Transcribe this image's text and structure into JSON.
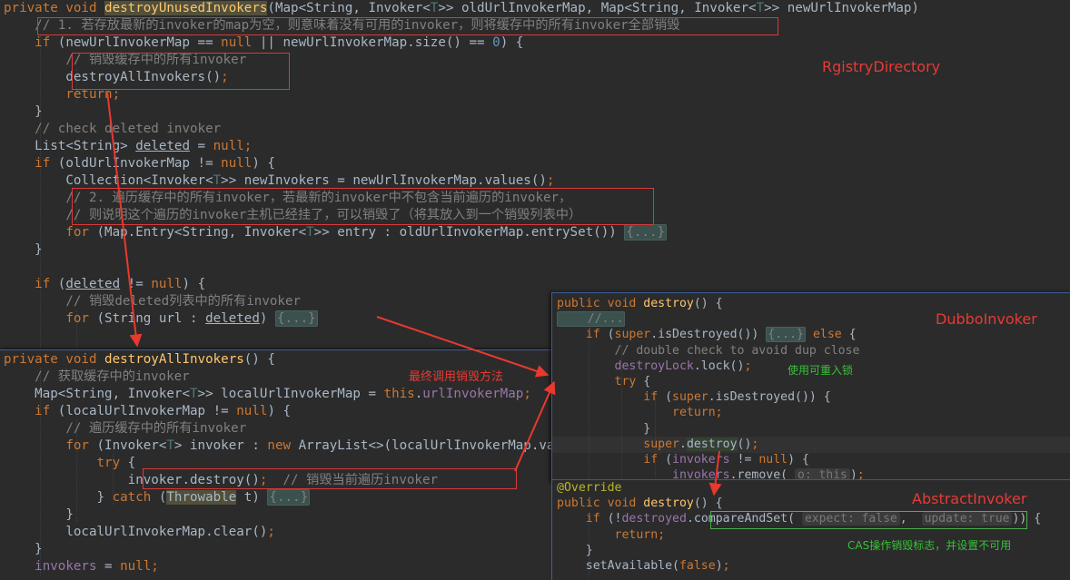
{
  "main_editor": {
    "lines": [
      {
        "p": [
          [
            "kw",
            "private void "
          ],
          [
            "fn hl-yel",
            "destroyUnusedInvokers"
          ],
          [
            "",
            "(Map<String, Invoker<"
          ],
          [
            "tp",
            "T"
          ],
          [
            "",
            ">> oldUrlInvokerMap, Map<String, Invoker<"
          ],
          [
            "tp",
            "T"
          ],
          [
            "",
            ">> newUrlInvokerMap)"
          ]
        ]
      },
      {
        "p": [
          [
            "cm",
            "    // 1. 若存放最新的invoker的map为空，则意味着没有可用的invoker，则将缓存中的所有invoker全部销毁"
          ]
        ]
      },
      {
        "p": [
          [
            "kw",
            "    if "
          ],
          [
            "",
            "(newUrlInvokerMap == "
          ],
          [
            "kw",
            "null"
          ],
          [
            "",
            " || newUrlInvokerMap.size() == "
          ],
          [
            "num",
            "0"
          ],
          [
            "",
            ") {"
          ]
        ]
      },
      {
        "p": [
          [
            "cm",
            "        // 销毁缓存中的所有invoker"
          ]
        ]
      },
      {
        "p": [
          [
            "",
            "        destroyAllInvokers()"
          ],
          [
            "kw",
            ";"
          ]
        ]
      },
      {
        "p": [
          [
            "kw",
            "        return;"
          ]
        ]
      },
      {
        "p": [
          [
            "",
            "    }"
          ]
        ]
      },
      {
        "p": [
          [
            "cm",
            "    // check deleted invoker"
          ]
        ]
      },
      {
        "p": [
          [
            "",
            "    List<String> "
          ],
          [
            "ul",
            "deleted"
          ],
          [
            "",
            " = "
          ],
          [
            "kw",
            "null;"
          ]
        ]
      },
      {
        "p": [
          [
            "kw",
            "    if "
          ],
          [
            "",
            "(oldUrlInvokerMap != "
          ],
          [
            "kw",
            "null"
          ],
          [
            "",
            ") {"
          ]
        ]
      },
      {
        "p": [
          [
            "",
            "        Collection<Invoker<"
          ],
          [
            "tp",
            "T"
          ],
          [
            "",
            ">> newInvokers = newUrlInvokerMap.values()"
          ],
          [
            "kw",
            ";"
          ]
        ]
      },
      {
        "p": [
          [
            "cm",
            "        // 2. 遍历缓存中的所有invoker，若最新的invoker中不包含当前遍历的invoker，"
          ]
        ]
      },
      {
        "p": [
          [
            "cm",
            "        // 则说明这个遍历的invoker主机已经挂了，可以销毁了（将其放入到一个销毁列表中）"
          ]
        ]
      },
      {
        "p": [
          [
            "kw",
            "        for "
          ],
          [
            "",
            "(Map.Entry<String, Invoker<"
          ],
          [
            "tp",
            "T"
          ],
          [
            "",
            ">> entry : oldUrlInvokerMap.entrySet()) "
          ],
          [
            "fold",
            "{...}"
          ]
        ]
      },
      {
        "p": [
          [
            "",
            "    }"
          ]
        ]
      },
      {
        "p": [
          [
            "",
            ""
          ]
        ]
      },
      {
        "p": [
          [
            "kw",
            "    if "
          ],
          [
            "",
            "("
          ],
          [
            "ul",
            "deleted"
          ],
          [
            "",
            " != "
          ],
          [
            "kw",
            "null"
          ],
          [
            "",
            ") {"
          ]
        ]
      },
      {
        "p": [
          [
            "cm",
            "        // 销毁deleted列表中的所有invoker"
          ]
        ]
      },
      {
        "p": [
          [
            "kw",
            "        for "
          ],
          [
            "",
            "(String url : "
          ],
          [
            "ul",
            "deleted"
          ],
          [
            "",
            ") "
          ],
          [
            "fold",
            "{...}"
          ]
        ]
      }
    ]
  },
  "bottom_editor": {
    "lines": [
      {
        "p": [
          [
            "kw",
            "private void "
          ],
          [
            "fn",
            "destroyAllInvokers"
          ],
          [
            "",
            "() {"
          ]
        ]
      },
      {
        "p": [
          [
            "cm",
            "    // 获取缓存中的invoker"
          ]
        ]
      },
      {
        "p": [
          [
            "",
            "    Map<String, Invoker<"
          ],
          [
            "tp",
            "T"
          ],
          [
            "",
            ">> localUrlInvokerMap = "
          ],
          [
            "kw",
            "this"
          ],
          [
            "",
            "."
          ],
          [
            "fld",
            "urlInvokerMap"
          ],
          [
            "kw",
            ";"
          ]
        ]
      },
      {
        "p": [
          [
            "kw",
            "    if "
          ],
          [
            "",
            "(localUrlInvokerMap != "
          ],
          [
            "kw",
            "null"
          ],
          [
            "",
            ") {"
          ]
        ]
      },
      {
        "p": [
          [
            "cm",
            "        // 遍历缓存中的所有invoker"
          ]
        ]
      },
      {
        "p": [
          [
            "kw",
            "        for "
          ],
          [
            "",
            "(Invoker<"
          ],
          [
            "tp",
            "T"
          ],
          [
            "",
            "> invoker : "
          ],
          [
            "kw",
            "new "
          ],
          [
            "",
            "ArrayList<>(localUrlInvokerMap.values())) {"
          ]
        ]
      },
      {
        "p": [
          [
            "kw",
            "            try "
          ],
          [
            "",
            "{"
          ]
        ]
      },
      {
        "p": [
          [
            "",
            "                invoker.destroy()"
          ],
          [
            "kw",
            ";"
          ],
          [
            "cm",
            "  // 销毁当前遍历invoker"
          ]
        ]
      },
      {
        "p": [
          [
            "",
            "            } "
          ],
          [
            "kw",
            "catch "
          ],
          [
            "",
            "("
          ],
          [
            "hl-yel",
            "Throwable"
          ],
          [
            "",
            " t) "
          ],
          [
            "fold",
            "{...}"
          ]
        ]
      },
      {
        "p": [
          [
            "",
            "        }"
          ]
        ]
      },
      {
        "p": [
          [
            "",
            "        localUrlInvokerMap.clear()"
          ],
          [
            "kw",
            ";"
          ]
        ]
      },
      {
        "p": [
          [
            "",
            "    }"
          ]
        ]
      },
      {
        "p": [
          [
            "fld",
            "    invokers"
          ],
          [
            "",
            " = "
          ],
          [
            "kw",
            "null;"
          ]
        ]
      }
    ]
  },
  "dubbo_editor": {
    "lines": [
      {
        "p": [
          [
            "kw",
            "public void "
          ],
          [
            "fn",
            "destroy"
          ],
          [
            "",
            "() {"
          ]
        ]
      },
      {
        "p": [
          [
            "fold",
            "    //..."
          ]
        ]
      },
      {
        "p": [
          [
            "kw",
            "    if "
          ],
          [
            "",
            "("
          ],
          [
            "kw",
            "super"
          ],
          [
            "",
            ".isDestroyed()) "
          ],
          [
            "fold",
            "{...}"
          ],
          [
            "",
            " "
          ],
          [
            "kw",
            "else "
          ],
          [
            "",
            "{"
          ]
        ]
      },
      {
        "p": [
          [
            "cm",
            "        // double check to avoid dup close"
          ]
        ]
      },
      {
        "p": [
          [
            "fld",
            "        destroyLock"
          ],
          [
            "",
            ".lock()"
          ],
          [
            "kw",
            ";"
          ]
        ]
      },
      {
        "p": [
          [
            "kw",
            "        try "
          ],
          [
            "",
            "{"
          ]
        ]
      },
      {
        "p": [
          [
            "kw",
            "            if "
          ],
          [
            "",
            "("
          ],
          [
            "kw",
            "super"
          ],
          [
            "",
            ".isDestroyed()) {"
          ]
        ]
      },
      {
        "p": [
          [
            "kw",
            "                return;"
          ]
        ]
      },
      {
        "p": [
          [
            "",
            "            }"
          ]
        ]
      },
      {
        "p": [
          [
            "kw",
            "            super"
          ],
          [
            "",
            "."
          ],
          [
            "hl-fn",
            "destroy"
          ],
          [
            "",
            "()"
          ],
          [
            "kw",
            ";"
          ]
        ]
      },
      {
        "p": [
          [
            "kw",
            "            if "
          ],
          [
            "",
            "("
          ],
          [
            "fld",
            "invokers"
          ],
          [
            "",
            " != "
          ],
          [
            "kw",
            "null"
          ],
          [
            "",
            ") {"
          ]
        ]
      },
      {
        "p": [
          [
            "fld",
            "                invokers"
          ],
          [
            "",
            ".remove( "
          ],
          [
            "hint",
            "o: this"
          ],
          [
            "",
            ")"
          ],
          [
            "kw",
            ";"
          ]
        ]
      }
    ]
  },
  "abstract_editor": {
    "lines": [
      {
        "p": [
          [
            "ann",
            "@Override"
          ]
        ]
      },
      {
        "p": [
          [
            "kw",
            "public void "
          ],
          [
            "fn",
            "destroy"
          ],
          [
            "",
            "() {"
          ]
        ]
      },
      {
        "p": [
          [
            "kw",
            "    if "
          ],
          [
            "",
            "(!"
          ],
          [
            "fld",
            "destroyed"
          ],
          [
            "",
            ".compareAndSet( "
          ],
          [
            "hint",
            "expect: false"
          ],
          [
            "",
            ",  "
          ],
          [
            "hint",
            "update: true"
          ],
          [
            "",
            ")) {"
          ]
        ]
      },
      {
        "p": [
          [
            "kw",
            "        return;"
          ]
        ]
      },
      {
        "p": [
          [
            "",
            "    }"
          ]
        ]
      },
      {
        "p": [
          [
            "",
            "    setAvailable("
          ],
          [
            "kw",
            "false"
          ],
          [
            "",
            ")"
          ],
          [
            "kw",
            ";"
          ]
        ]
      }
    ]
  },
  "labels": {
    "registry_directory": "RgistryDirectory",
    "dubbo_invoker": "DubboInvoker",
    "abstract_invoker": "AbstractInvoker",
    "final_call": "最终调用销毁方法",
    "reentrant_lock": "使用可重入锁",
    "cas_flag": "CAS操作销毁标志，并设置不可用"
  },
  "colors": {
    "editor_bg": "#2b2b2b",
    "keyword": "#cc7832",
    "function": "#ffc66d",
    "comment": "#808080",
    "number": "#6897bb",
    "field": "#9876aa",
    "annotation": "#bbb529",
    "type_param": "#507874",
    "annotation_red": "#e83a34",
    "annotation_green": "#38c038"
  }
}
